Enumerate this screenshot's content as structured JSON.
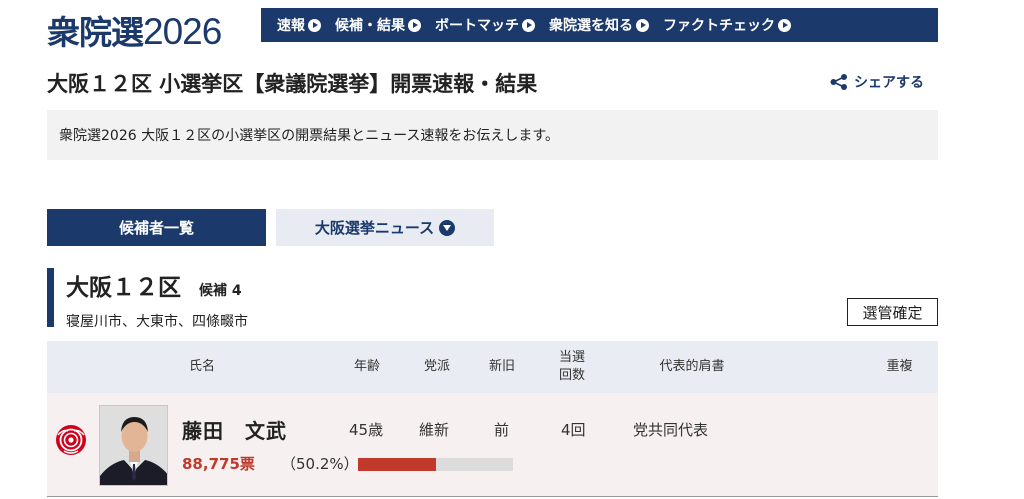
{
  "brand": {
    "kanji": "衆院選",
    "year": "2026"
  },
  "nav": {
    "items": [
      {
        "label": "速報"
      },
      {
        "label": "候補・結果"
      },
      {
        "label": "ボートマッチ"
      },
      {
        "label": "衆院選を知る"
      },
      {
        "label": "ファクトチェック"
      }
    ]
  },
  "page": {
    "title": "大阪１２区 小選挙区【衆議院選挙】開票速報・結果",
    "share_label": "シェアする",
    "intro": "衆院選2026 大阪１２区の小選挙区の開票結果とニュース速報をお伝えします。"
  },
  "tabs": {
    "candidates": "候補者一覧",
    "news": "大阪選挙ニュース"
  },
  "district": {
    "name": "大阪１２区",
    "count": "候補 4",
    "area": "寝屋川市、大東市、四條畷市",
    "status_badge": "選管確定"
  },
  "table": {
    "headers": {
      "name": "氏名",
      "age": "年齢",
      "party": "党派",
      "status": "新旧",
      "wins_line1": "当選",
      "wins_line2": "回数",
      "title": "代表的肩書",
      "dual": "重複"
    },
    "rows": [
      {
        "name": "藤田　文武",
        "age": "45歳",
        "party": "維新",
        "status": "前",
        "wins": "4回",
        "title": "党共同代表",
        "dual": "",
        "votes": "88,775票",
        "percent_label": "（50.2%）",
        "vote_share": 0.502,
        "winner_icon": "rose-icon"
      }
    ]
  },
  "colors": {
    "navy": "#1b3a6b",
    "winner_red": "#c0392b",
    "header_bg": "#e9edf3",
    "row_bg": "#f7f0f0"
  }
}
